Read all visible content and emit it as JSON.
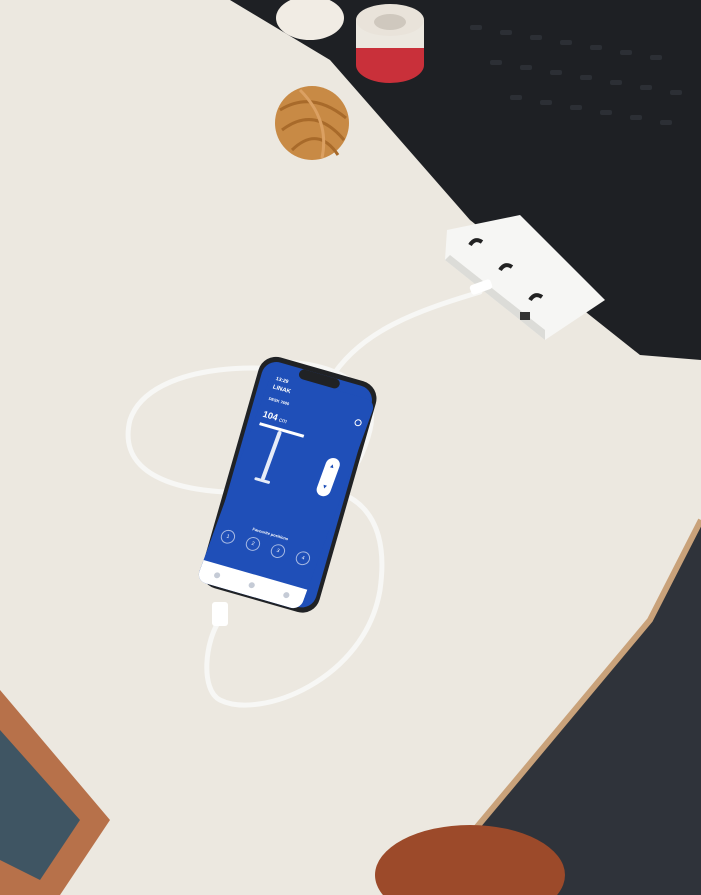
{
  "colors": {
    "desk_surface": "#ece8e0",
    "pegboard": "#1e2024",
    "floor": "#2f333a",
    "phone_screen": "#1f4fb8",
    "cable": "#f7f7f5",
    "tape_red": "#c9303a",
    "twine_ball": "#c88a45",
    "frame_wood": "#b7714a"
  },
  "phone_app": {
    "status_time": "13:29",
    "app_name": "LINAK",
    "device_name": "DESK 7600",
    "height_value": "104",
    "height_unit": "cm",
    "favourite_label": "Favourite positions",
    "favourite_buttons": [
      "1",
      "2",
      "3",
      "4"
    ],
    "icons": {
      "settings": "gear-icon",
      "up": "chevron-up-icon",
      "down": "chevron-down-icon"
    }
  }
}
